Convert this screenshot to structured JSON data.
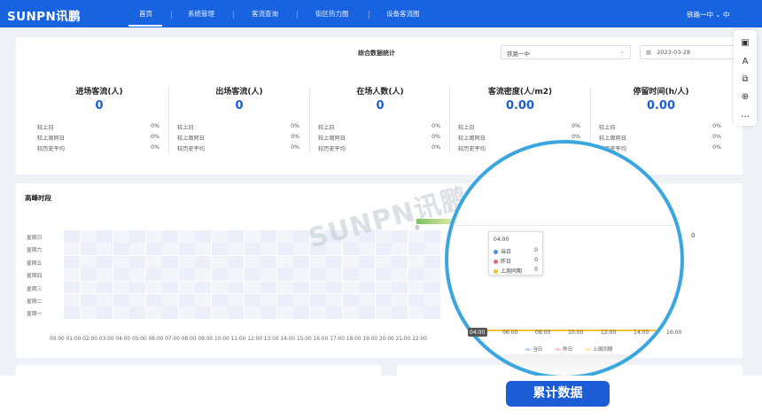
{
  "brand": {
    "logo_text": "SUNPN讯鹏"
  },
  "nav": {
    "items": [
      "首页",
      "系统管理",
      "客流查询",
      "街区热力图",
      "设备客流图"
    ],
    "active": "首页",
    "user": "铁路一中 ⌄ 中"
  },
  "toolbar": {
    "icons": [
      "image-icon",
      "translate-icon",
      "split-icon",
      "zoom-icon",
      "more-icon"
    ],
    "more": "…"
  },
  "stats": {
    "title": "综合数据统计",
    "site_select": "铁路一中",
    "date": "2023-03-28",
    "metrics": [
      {
        "label": "进场客流(人)",
        "value": "0",
        "rows": [
          [
            "较上日",
            "0%"
          ],
          [
            "较上周同日",
            "0%"
          ],
          [
            "较历史平均",
            "0%"
          ]
        ]
      },
      {
        "label": "出场客流(人)",
        "value": "0",
        "rows": [
          [
            "较上日",
            "0%"
          ],
          [
            "较上周同日",
            "0%"
          ],
          [
            "较历史平均",
            "0%"
          ]
        ]
      },
      {
        "label": "在场人数(人)",
        "value": "0",
        "rows": [
          [
            "较上日",
            "0%"
          ],
          [
            "较上周同日",
            "0%"
          ],
          [
            "较历史平均",
            "0%"
          ]
        ]
      },
      {
        "label": "客流密度(人/m2)",
        "value": "0.00",
        "rows": [
          [
            "较上日",
            "0%"
          ],
          [
            "较上周同日",
            "0%"
          ],
          [
            "较历史平均",
            "0%"
          ]
        ]
      },
      {
        "label": "停留时间(h/人)",
        "value": "0.00",
        "rows": [
          [
            "较上日",
            "0%"
          ],
          [
            "较上周同日",
            "0%"
          ],
          [
            "较历史平均",
            "0%"
          ]
        ]
      }
    ]
  },
  "peak": {
    "title": "高峰时段",
    "y_labels": [
      "星期日",
      "星期六",
      "星期五",
      "星期四",
      "星期三",
      "星期二",
      "星期一"
    ],
    "x_labels": [
      "00:00",
      "01:00",
      "02:00",
      "03:00",
      "04:00",
      "05:00",
      "06:00",
      "07:00",
      "08:00",
      "09:00",
      "10:00",
      "11:00",
      "12:00",
      "13:00",
      "14:00",
      "15:00",
      "16:00",
      "17:00",
      "18:00",
      "19:00",
      "20:00",
      "21:00",
      "22:00"
    ],
    "scale_min": "0",
    "scale_max": "0"
  },
  "magnifier": {
    "tooltip": {
      "time": "04:00",
      "rows": [
        {
          "name": "当日",
          "value": "0",
          "color": "#4a90e2"
        },
        {
          "name": "昨日",
          "value": "0",
          "color": "#e86a6a"
        },
        {
          "name": "上周同期",
          "value": "0",
          "color": "#f2c230"
        }
      ]
    },
    "x_labels": [
      "04:00",
      "06:00",
      "08:00",
      "10:00",
      "12:00",
      "14:00",
      "16:00"
    ],
    "legend": [
      "当日",
      "昨日",
      "上周同期"
    ]
  },
  "watermark": "SUNPN讯鹏",
  "cta_label": "累计数据",
  "colors": {
    "primary": "#1763e0",
    "accent": "#1a5ddb",
    "ring": "#3aa6df"
  }
}
